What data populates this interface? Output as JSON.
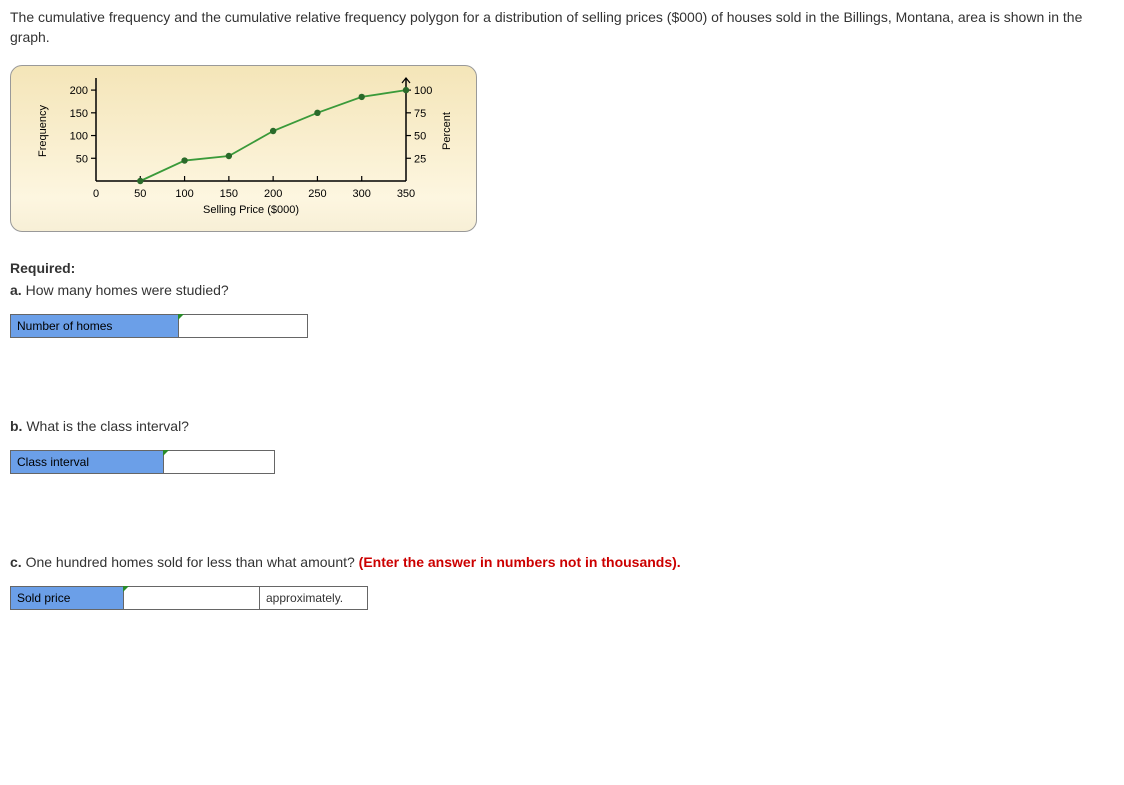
{
  "intro": "The cumulative frequency and the cumulative relative frequency polygon for a distribution of selling prices ($000) of houses sold in the Billings, Montana, area is shown in the graph.",
  "required_heading": "Required:",
  "qa": {
    "prefix": "a.",
    "text": " How many homes were studied?",
    "label": "Number of homes"
  },
  "qb": {
    "prefix": "b.",
    "text": " What is the class interval?",
    "label": "Class interval"
  },
  "qc": {
    "prefix": "c.",
    "text": " One hundred homes sold for less than what amount? ",
    "note": "(Enter the answer in numbers not in thousands).",
    "label": "Sold price",
    "suffix": "approximately."
  },
  "chart_data": {
    "type": "line",
    "xlabel": "Selling Price ($000)",
    "ylabel_left": "Frequency",
    "ylabel_right": "Percent",
    "x_ticks": [
      0,
      50,
      100,
      150,
      200,
      250,
      300,
      350
    ],
    "y_ticks_left": [
      50,
      100,
      150,
      200
    ],
    "y_ticks_right": [
      25,
      50,
      75,
      100
    ],
    "xlim": [
      0,
      350
    ],
    "ylim_left": [
      0,
      220
    ],
    "ylim_right": [
      0,
      110
    ],
    "series": [
      {
        "name": "Cumulative Frequency",
        "x": [
          50,
          100,
          150,
          200,
          250,
          300,
          350
        ],
        "y_freq": [
          0,
          45,
          55,
          110,
          150,
          185,
          200
        ],
        "y_pct": [
          0,
          22,
          27,
          55,
          75,
          92,
          100
        ]
      }
    ]
  }
}
